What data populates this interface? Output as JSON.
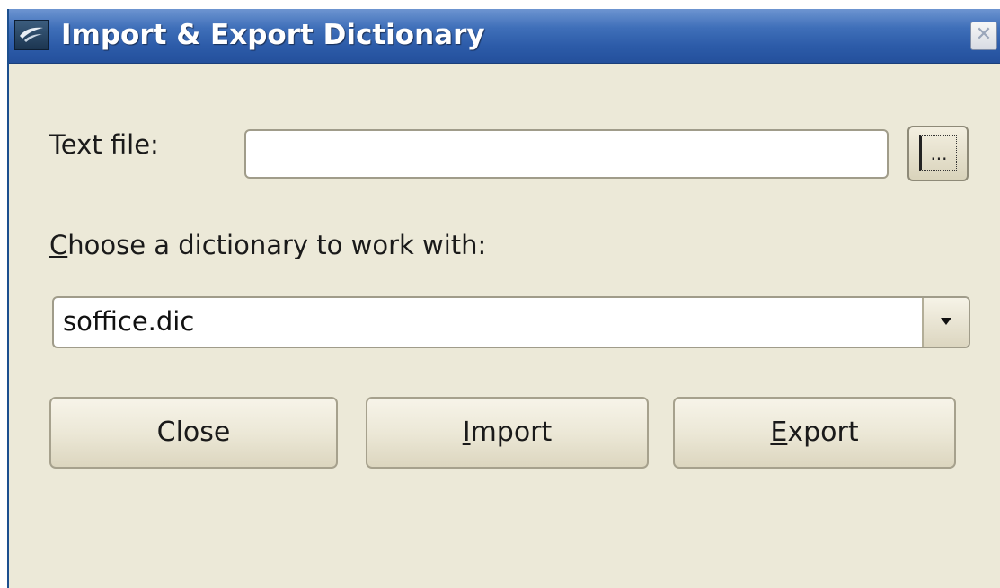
{
  "window": {
    "title": "Import & Export Dictionary",
    "close_icon": "close-icon"
  },
  "form": {
    "text_file_label": "Text file:",
    "text_file_value": "",
    "browse_label": "...",
    "dictionary_label_mnemonic": "C",
    "dictionary_label_rest": "hoose a dictionary to work with:",
    "dictionary_selected": "soffice.dic"
  },
  "buttons": {
    "close": "Close",
    "import_mnemonic": "I",
    "import_rest": "mport",
    "export_mnemonic": "E",
    "export_rest": "xport"
  },
  "colors": {
    "titlebar": "#2c5ba8",
    "dialog_bg": "#ece9d8"
  }
}
